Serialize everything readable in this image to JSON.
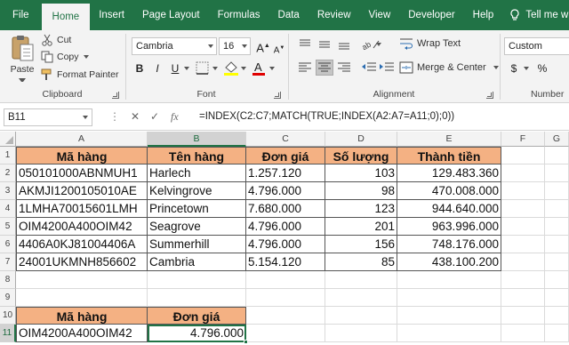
{
  "tabs": [
    "File",
    "Home",
    "Insert",
    "Page Layout",
    "Formulas",
    "Data",
    "Review",
    "View",
    "Developer",
    "Help"
  ],
  "active_tab": "Home",
  "tell_me": "Tell me wh",
  "ribbon": {
    "clipboard": {
      "paste": "Paste",
      "cut": "Cut",
      "copy": "Copy",
      "format_painter": "Format Painter",
      "label": "Clipboard"
    },
    "font": {
      "name": "Cambria",
      "size": "16",
      "bold": "B",
      "italic": "I",
      "underline": "U",
      "grow": "A",
      "shrink": "A",
      "color_letter": "A",
      "label": "Font"
    },
    "alignment": {
      "wrap_text": "Wrap Text",
      "merge_center": "Merge & Center",
      "label": "Alignment"
    },
    "number": {
      "format": "Custom",
      "currency": "$",
      "percent": "%",
      "label": "Number"
    }
  },
  "formula_bar": {
    "name_box": "B11",
    "formula": "=INDEX(C2:C7;MATCH(TRUE;INDEX(A2:A7=A11;0);0))"
  },
  "columns": [
    "A",
    "B",
    "C",
    "D",
    "E",
    "F",
    "G"
  ],
  "rows": [
    "1",
    "2",
    "3",
    "4",
    "5",
    "6",
    "7",
    "8",
    "9",
    "10",
    "11"
  ],
  "table": {
    "headers": [
      "Mã hàng",
      "Tên hàng",
      "Đơn giá",
      "Số lượng",
      "Thành tiền"
    ],
    "rows": [
      [
        "050101000ABNMUH1",
        "Harlech",
        "1.257.120",
        "103",
        "129.483.360"
      ],
      [
        "AKMJI1200105010AE",
        "Kelvingrove",
        "4.796.000",
        "98",
        "470.008.000"
      ],
      [
        "1LMHA70015601LMH",
        "Princetown",
        "7.680.000",
        "123",
        "944.640.000"
      ],
      [
        "OIM4200A400OIM42",
        "Seagrove",
        "4.796.000",
        "201",
        "963.996.000"
      ],
      [
        "4406A0KJ81004406A",
        "Summerhill",
        "4.796.000",
        "156",
        "748.176.000"
      ],
      [
        "24001UKMNH856602",
        "Cambria",
        "5.154.120",
        "85",
        "438.100.200"
      ]
    ]
  },
  "lookup": {
    "headers": [
      "Mã hàng",
      "Đơn giá"
    ],
    "code": "OIM4200A400OIM42",
    "price": "4.796.000"
  },
  "colors": {
    "excel_green": "#217346",
    "header_fill": "#f4b183"
  }
}
